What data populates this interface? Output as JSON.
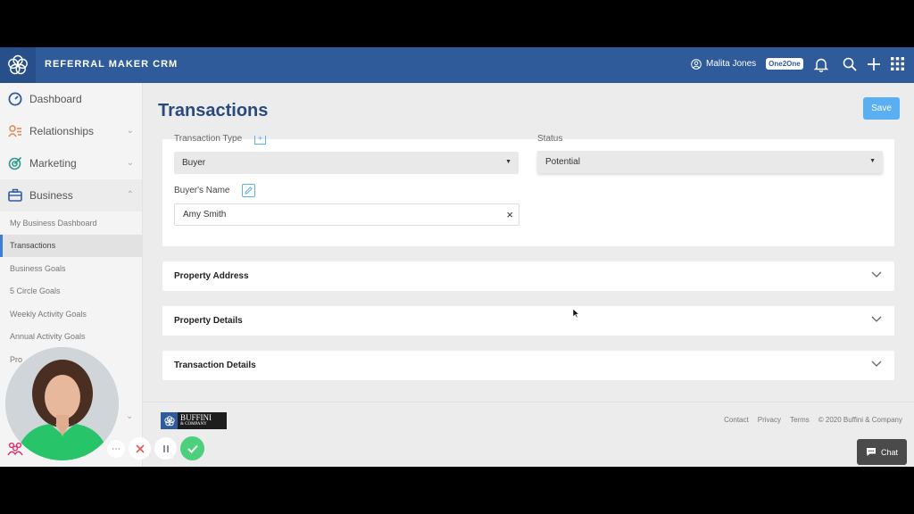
{
  "app": {
    "title": "REFERRAL MAKER CRM"
  },
  "header": {
    "user_name": "Malita Jones",
    "user_badge": "One2One"
  },
  "sidebar": {
    "items": [
      {
        "label": "Dashboard",
        "icon": "dashboard-icon"
      },
      {
        "label": "Relationships",
        "icon": "relationships-icon"
      },
      {
        "label": "Marketing",
        "icon": "marketing-icon"
      },
      {
        "label": "Business",
        "icon": "business-icon"
      }
    ],
    "sub_items": [
      "My Business Dashboard",
      "Transactions",
      "Business Goals",
      "5 Circle Goals",
      "Weekly Activity Goals",
      "Annual Activity Goals",
      "Pro"
    ]
  },
  "page": {
    "title": "Transactions",
    "save_label": "Save"
  },
  "form": {
    "transaction_type_label": "Transaction Type",
    "transaction_type_value": "Buyer",
    "status_label": "Status",
    "status_value": "Potential",
    "buyers_name_label": "Buyer's Name",
    "buyers_name_value": "Amy Smith"
  },
  "sections": [
    "Property Address",
    "Property Details",
    "Transaction Details"
  ],
  "footer": {
    "logo_line1": "BUFFINI",
    "logo_line2": "& COMPANY",
    "links": [
      "Contact",
      "Privacy",
      "Terms"
    ],
    "copyright": "© 2020 Buffini & Company"
  },
  "chat": {
    "label": "Chat"
  },
  "colors": {
    "brand": "#2f5b9b",
    "save": "#5aaef2",
    "confirm": "#4cd07d",
    "cancel": "#e05a5a"
  }
}
